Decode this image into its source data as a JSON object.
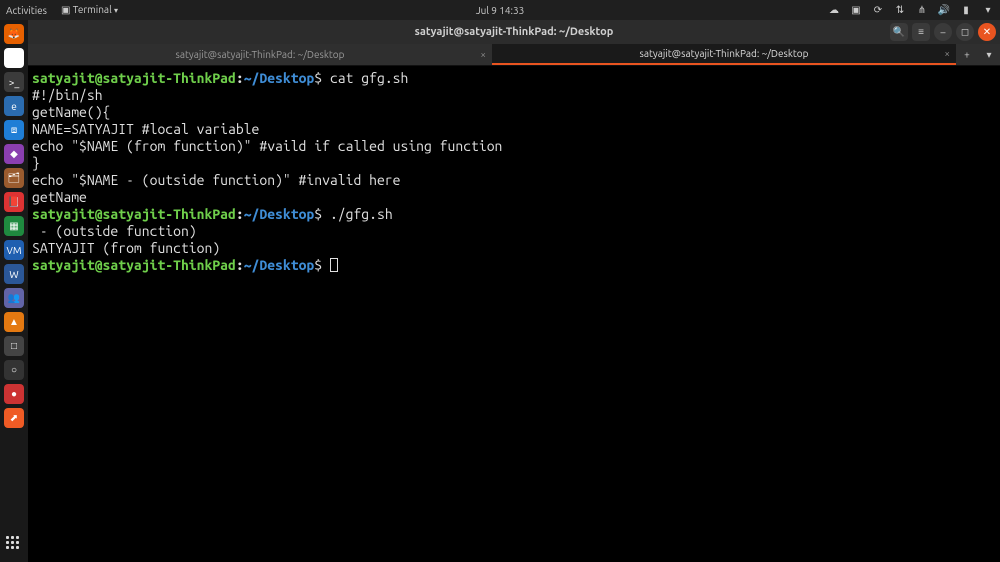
{
  "topbar": {
    "activities": "Activities",
    "app_indicator": "Terminal",
    "datetime": "Jul 9  14:33"
  },
  "dock": {
    "items": [
      {
        "name": "firefox",
        "bg": "#e66000",
        "glyph": "🦊"
      },
      {
        "name": "chrome",
        "bg": "#ffffff",
        "glyph": "◉"
      },
      {
        "name": "terminal",
        "bg": "#3b3b3b",
        "glyph": ">_"
      },
      {
        "name": "edge",
        "bg": "#2b6cb0",
        "glyph": "e"
      },
      {
        "name": "vscode",
        "bg": "#1f7ed6",
        "glyph": "⧈"
      },
      {
        "name": "app-purple",
        "bg": "#8a3fb0",
        "glyph": "◆"
      },
      {
        "name": "files",
        "bg": "#9a5b2e",
        "glyph": "🗂"
      },
      {
        "name": "pdf",
        "bg": "#d33",
        "glyph": "📕"
      },
      {
        "name": "sheets",
        "bg": "#1f8a3f",
        "glyph": "▦"
      },
      {
        "name": "vbox",
        "bg": "#1f5fb0",
        "glyph": "VM"
      },
      {
        "name": "word",
        "bg": "#2b5797",
        "glyph": "W"
      },
      {
        "name": "teams",
        "bg": "#6264a7",
        "glyph": "👥"
      },
      {
        "name": "vlc",
        "bg": "#e47911",
        "glyph": "▲"
      },
      {
        "name": "app-grey",
        "bg": "#444",
        "glyph": "□"
      },
      {
        "name": "app-dark",
        "bg": "#333",
        "glyph": "○"
      },
      {
        "name": "app-red",
        "bg": "#cc3333",
        "glyph": "●"
      },
      {
        "name": "postman",
        "bg": "#ef5b25",
        "glyph": "⬈"
      }
    ]
  },
  "window": {
    "title": "satyajit@satyajit-ThinkPad: ~/Desktop"
  },
  "tabs": [
    {
      "title": "satyajit@satyajit-ThinkPad: ~/Desktop",
      "active": false
    },
    {
      "title": "satyajit@satyajit-ThinkPad: ~/Desktop",
      "active": true
    }
  ],
  "prompt": {
    "user_host": "satyajit@satyajit-ThinkPad",
    "sep": ":",
    "path": "~/Desktop",
    "symbol": "$"
  },
  "session": {
    "cmd1": "cat gfg.sh",
    "file_line1": "#!/bin/sh",
    "file_line2": "",
    "file_line3": "getName(){",
    "file_line4": "NAME=SATYAJIT #local variable",
    "file_line5": "echo \"$NAME (from function)\" #vaild if called using function",
    "file_line6": "}",
    "file_line7": "",
    "file_line8": "echo \"$NAME - (outside function)\" #invalid here",
    "file_line9": "getName",
    "cmd2": "./gfg.sh",
    "out1": " - (outside function)",
    "out2": "SATYAJIT (from function)"
  }
}
